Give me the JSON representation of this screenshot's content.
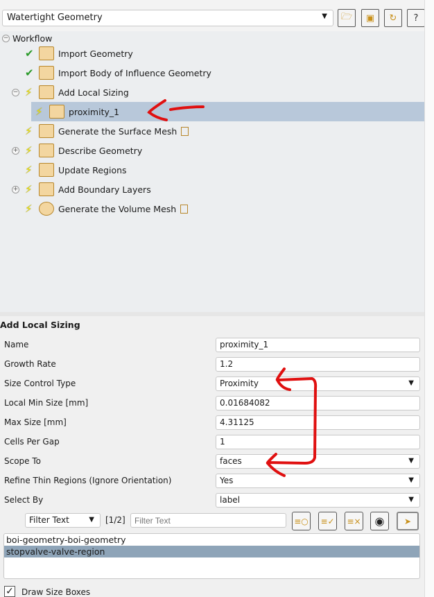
{
  "workflow_select": {
    "value": "Watertight Geometry"
  },
  "toolbar": {
    "icons": [
      "open-folder-icon",
      "save-icon",
      "refresh-icon",
      "help-icon"
    ],
    "help": "?"
  },
  "tree": {
    "root": "Workflow",
    "items": [
      {
        "label": "Import Geometry",
        "status": "done"
      },
      {
        "label": "Import Body of Influence Geometry",
        "status": "done"
      },
      {
        "label": "Add Local Sizing",
        "status": "pending"
      },
      {
        "label": "proximity_1",
        "status": "pending"
      },
      {
        "label": "Generate the Surface Mesh",
        "status": "pending"
      },
      {
        "label": "Describe Geometry",
        "status": "pending"
      },
      {
        "label": "Update Regions",
        "status": "pending"
      },
      {
        "label": "Add Boundary Layers",
        "status": "pending"
      },
      {
        "label": "Generate the Volume Mesh",
        "status": "pending"
      }
    ]
  },
  "form": {
    "title": "Add Local Sizing",
    "fields": [
      {
        "label": "Name",
        "value": "proximity_1"
      },
      {
        "label": "Growth Rate",
        "value": "1.2"
      },
      {
        "label": "Size Control Type",
        "value": "Proximity"
      },
      {
        "label": "Local Min Size [mm]",
        "value": "0.01684082"
      },
      {
        "label": "Max Size [mm]",
        "value": "4.31125"
      },
      {
        "label": "Cells Per Gap",
        "value": "1"
      },
      {
        "label": "Scope To",
        "value": "faces"
      },
      {
        "label": "Refine Thin Regions (Ignore Orientation)",
        "value": "Yes"
      },
      {
        "label": "Select By",
        "value": "label"
      }
    ],
    "filter_mode": "Filter Text",
    "count": "[1/2]",
    "filter_placeholder": "Filter Text",
    "list": [
      "boi-geometry-boi-geometry",
      "stopvalve-valve-region"
    ],
    "draw_size_boxes": "Draw Size Boxes"
  },
  "annotation_color": "#e01010"
}
